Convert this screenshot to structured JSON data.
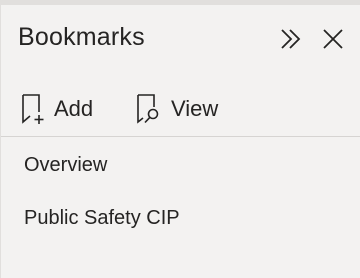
{
  "pane": {
    "title": "Bookmarks",
    "expand_icon": "double-chevron-right-icon",
    "close_icon": "close-icon"
  },
  "actions": {
    "add_label": "Add",
    "add_icon": "bookmark-add-icon",
    "view_label": "View",
    "view_icon": "bookmark-view-icon"
  },
  "bookmarks": [
    {
      "label": "Overview"
    },
    {
      "label": "Public Safety CIP"
    }
  ]
}
